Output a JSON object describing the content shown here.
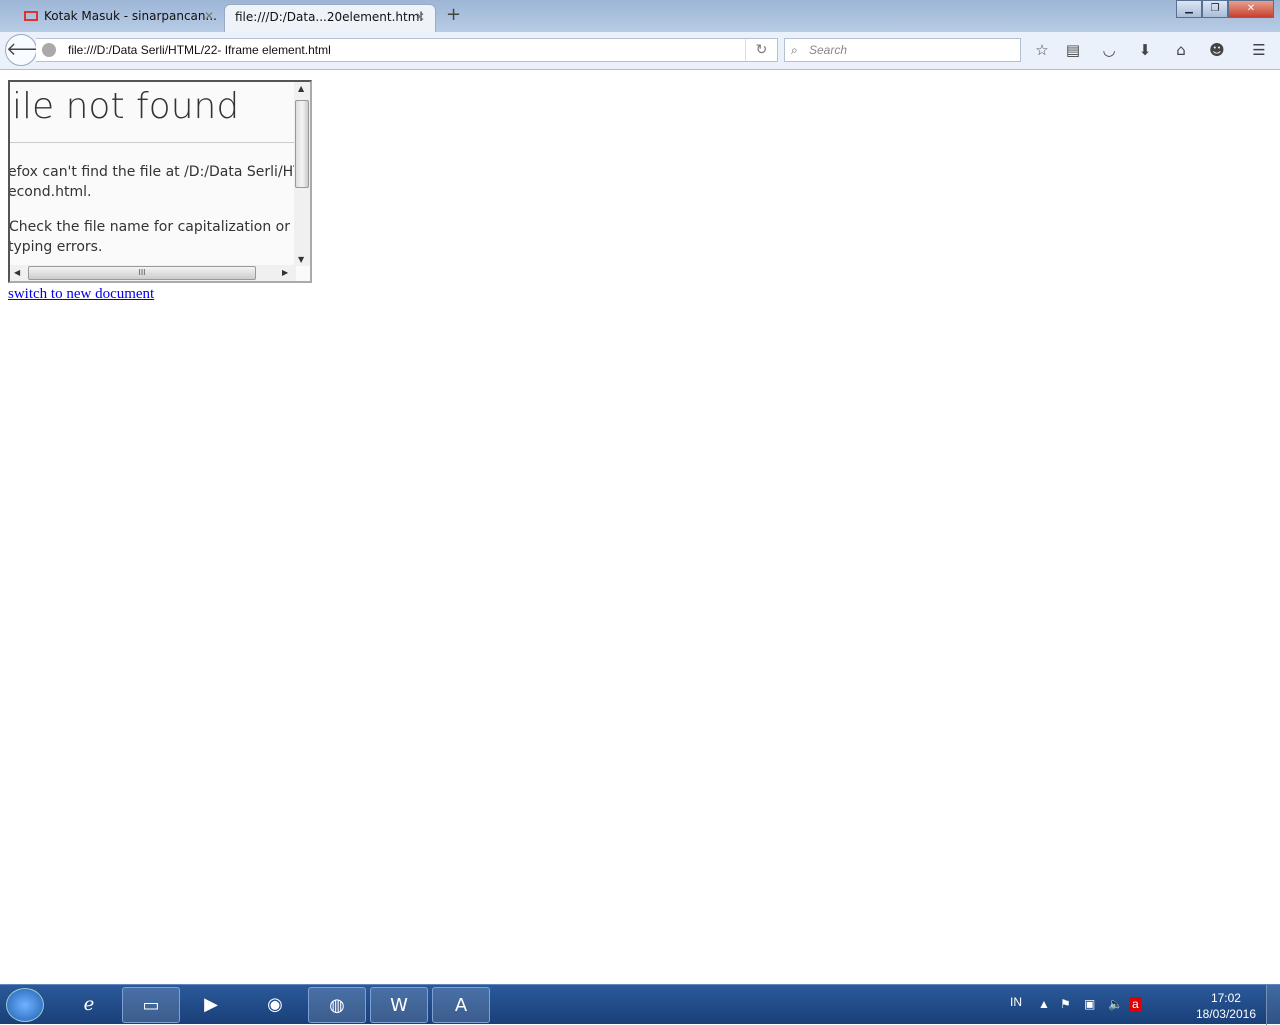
{
  "browser": {
    "tabs": [
      {
        "label": "Kotak Masuk - sinarpancan...",
        "icon": "gmail-icon"
      },
      {
        "label": "file:///D:/Data...20element.html",
        "active": true
      }
    ],
    "new_tab": "+",
    "url": "file:///D:/Data Serli/HTML/22- Iframe element.html",
    "search_placeholder": "Search",
    "close_glyph": "✕"
  },
  "iframe": {
    "title": "ile not found",
    "p1_line1": "efox can't find the file at /D:/Data Serli/HTM",
    "p1_line2": "econd.html.",
    "p2_line1": "Check the file name for capitalization or oth",
    "p2_line2": "typing errors.",
    "hthumb_grip": "III"
  },
  "link": "switch to new document",
  "taskbar": {
    "lang": "IN",
    "time": "17:02",
    "date": "18/03/2016"
  }
}
